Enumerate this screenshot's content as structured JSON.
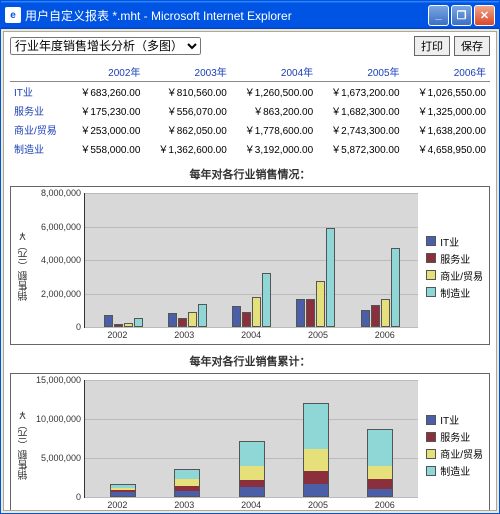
{
  "window": {
    "title": "用户自定义报表 *.mht - Microsoft Internet Explorer",
    "min": "_",
    "max": "❐",
    "close": "✕",
    "ie": "e"
  },
  "controls": {
    "dropdown_selected": "行业年度销售增长分析（多图）",
    "print": "打印",
    "save": "保存"
  },
  "table": {
    "years": [
      "2002年",
      "2003年",
      "2004年",
      "2005年",
      "2006年"
    ],
    "rows": [
      {
        "name": "IT业",
        "cells": [
          "￥683,260.00",
          "￥810,560.00",
          "￥1,260,500.00",
          "￥1,673,200.00",
          "￥1,026,550.00"
        ]
      },
      {
        "name": "服务业",
        "cells": [
          "￥175,230.00",
          "￥556,070.00",
          "￥863,200.00",
          "￥1,682,300.00",
          "￥1,325,000.00"
        ]
      },
      {
        "name": "商业/贸易",
        "cells": [
          "￥253,000.00",
          "￥862,050.00",
          "￥1,778,600.00",
          "￥2,743,300.00",
          "￥1,638,200.00"
        ]
      },
      {
        "name": "制造业",
        "cells": [
          "￥558,000.00",
          "￥1,362,600.00",
          "￥3,192,000.00",
          "￥5,872,300.00",
          "￥4,658,950.00"
        ]
      }
    ]
  },
  "chart_data": [
    {
      "title": "每年对各行业销售情况：",
      "type": "bar",
      "ylabel": "销售额（元）￥",
      "categories": [
        "2002",
        "2003",
        "2004",
        "2005",
        "2006"
      ],
      "series": [
        {
          "name": "IT业",
          "color": "#4a5fa8",
          "values": [
            683260,
            810560,
            1260500,
            1673200,
            1026550
          ]
        },
        {
          "name": "服务业",
          "color": "#8b2f3d",
          "values": [
            175230,
            556070,
            863200,
            1682300,
            1325000
          ]
        },
        {
          "name": "商业/贸易",
          "color": "#e6e07a",
          "values": [
            253000,
            862050,
            1778600,
            2743300,
            1638200
          ]
        },
        {
          "name": "制造业",
          "color": "#8fd6d6",
          "values": [
            558000,
            1362600,
            3192000,
            5872300,
            4658950
          ]
        }
      ],
      "ylim": [
        0,
        8000000
      ],
      "yticks": [
        0,
        2000000,
        4000000,
        6000000,
        8000000
      ],
      "ytick_labels": [
        "0",
        "2,000,000",
        "4,000,000",
        "6,000,000",
        "8,000,000"
      ],
      "height": 135
    },
    {
      "title": "每年对各行业销售累计：",
      "type": "stacked_bar",
      "ylabel": "销售额（元）￥",
      "categories": [
        "2002",
        "2003",
        "2004",
        "2005",
        "2006"
      ],
      "series": [
        {
          "name": "IT业",
          "color": "#4a5fa8",
          "values": [
            683260,
            810560,
            1260500,
            1673200,
            1026550
          ]
        },
        {
          "name": "服务业",
          "color": "#8b2f3d",
          "values": [
            175230,
            556070,
            863200,
            1682300,
            1325000
          ]
        },
        {
          "name": "商业/贸易",
          "color": "#e6e07a",
          "values": [
            253000,
            862050,
            1778600,
            2743300,
            1638200
          ]
        },
        {
          "name": "制造业",
          "color": "#8fd6d6",
          "values": [
            558000,
            1362600,
            3192000,
            5872300,
            4658950
          ]
        }
      ],
      "ylim": [
        0,
        15000000
      ],
      "yticks": [
        0,
        5000000,
        10000000,
        15000000
      ],
      "ytick_labels": [
        "0",
        "5,000,000",
        "10,000,000",
        "15,000,000"
      ],
      "height": 118
    }
  ]
}
